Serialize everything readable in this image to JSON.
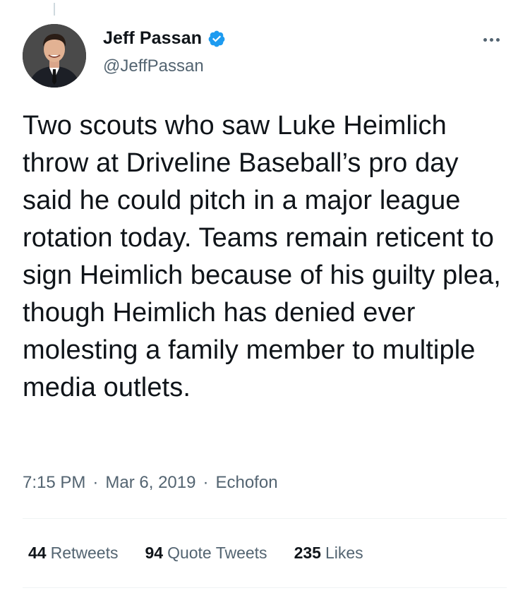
{
  "author": {
    "display_name": "Jeff Passan",
    "handle": "@JeffPassan",
    "verified": true
  },
  "tweet": {
    "text": "Two scouts who saw Luke Heimlich throw at Driveline Baseball’s pro day said he could pitch in a major league rotation today. Teams remain reticent to sign Heimlich because of his guilty plea, though Heimlich has denied ever molesting a family member to multiple media outlets.",
    "time": "7:15 PM",
    "date": "Mar 6, 2019",
    "source": "Echofon",
    "separator": "·"
  },
  "stats": {
    "retweets": {
      "count": "44",
      "label": "Retweets"
    },
    "quotes": {
      "count": "94",
      "label": "Quote Tweets"
    },
    "likes": {
      "count": "235",
      "label": "Likes"
    }
  },
  "colors": {
    "verified_blue": "#1d9bf0",
    "secondary_text": "#536471",
    "primary_text": "#0f1419",
    "divider": "#eff3f4"
  },
  "icons": {
    "verified": "verified-badge-icon",
    "more": "more-horizontal-icon"
  }
}
